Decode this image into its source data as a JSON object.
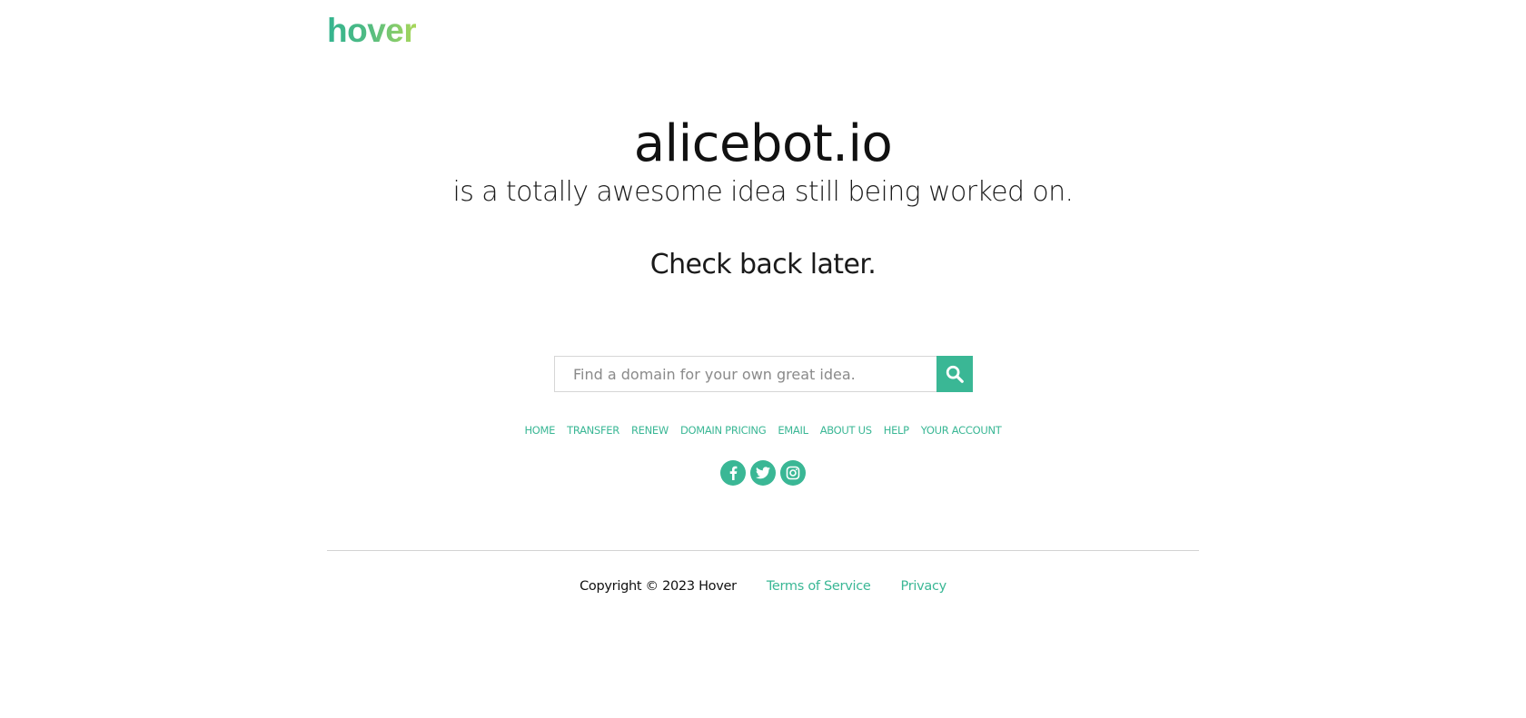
{
  "brand": {
    "logo_text": "hover",
    "colors": {
      "accent": "#3ab795",
      "logo_gradient_end": "#a9d75a",
      "divider": "#d3d3d3"
    }
  },
  "hero": {
    "domain": "alicebot.io",
    "tagline": "is a totally awesome idea still being worked on.",
    "message": "Check back later."
  },
  "search": {
    "placeholder": "Find a domain for your own great idea.",
    "value": "",
    "button_icon": "search-icon"
  },
  "nav": {
    "items": [
      {
        "label": "HOME"
      },
      {
        "label": "TRANSFER"
      },
      {
        "label": "RENEW"
      },
      {
        "label": "DOMAIN PRICING"
      },
      {
        "label": "EMAIL"
      },
      {
        "label": "ABOUT US"
      },
      {
        "label": "HELP"
      },
      {
        "label": "YOUR ACCOUNT"
      }
    ]
  },
  "social": {
    "items": [
      {
        "name": "facebook",
        "icon": "facebook-icon"
      },
      {
        "name": "twitter",
        "icon": "twitter-icon"
      },
      {
        "name": "instagram",
        "icon": "instagram-icon"
      }
    ]
  },
  "footer": {
    "copyright": "Copyright © 2023 Hover",
    "terms_label": "Terms of Service",
    "privacy_label": "Privacy"
  }
}
